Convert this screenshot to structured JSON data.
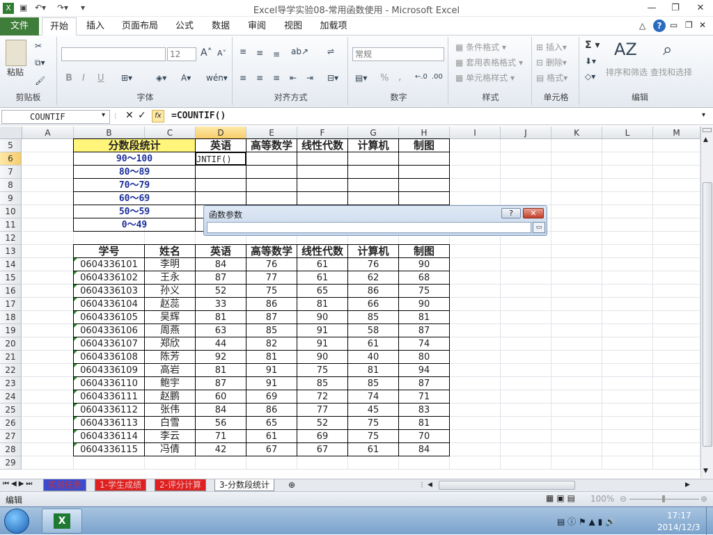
{
  "window": {
    "title": "Excel导学实验08-常用函数使用 - Microsoft Excel"
  },
  "quick_access": {
    "save_icon": "save-icon",
    "undo_icon": "undo-icon",
    "redo_icon": "redo-icon",
    "customize_icon": "dropdown-icon"
  },
  "ribbon_tabs": [
    "文件",
    "开始",
    "插入",
    "页面布局",
    "公式",
    "数据",
    "审阅",
    "视图",
    "加载项"
  ],
  "ribbon": {
    "clipboard": {
      "paste": "粘贴",
      "label": "剪贴板"
    },
    "font": {
      "font_name": "",
      "font_size": "12",
      "bold": "B",
      "italic": "I",
      "underline": "U",
      "label": "字体"
    },
    "alignment": {
      "label": "对齐方式"
    },
    "number": {
      "format": "常规",
      "percent": "%",
      "comma": ",",
      "label": "数字"
    },
    "styles": {
      "cond": "条件格式",
      "table": "套用表格格式",
      "cell": "单元格样式",
      "label": "样式"
    },
    "cells": {
      "insert": "插入",
      "delete": "删除",
      "format": "格式",
      "label": "单元格"
    },
    "editing": {
      "sum": "Σ",
      "sort": "排序和筛选",
      "find": "查找和选择",
      "label": "编辑"
    }
  },
  "formula_bar": {
    "name_box": "COUNTIF",
    "fx": "fx",
    "formula": "=COUNTIF()"
  },
  "columns": [
    "A",
    "B",
    "C",
    "D",
    "E",
    "F",
    "G",
    "H",
    "I",
    "J",
    "K",
    "L",
    "M"
  ],
  "rows": [
    "5",
    "6",
    "7",
    "8",
    "9",
    "10",
    "11",
    "12",
    "13",
    "14",
    "15",
    "16",
    "17",
    "18",
    "19",
    "20",
    "21",
    "22",
    "23",
    "24",
    "25",
    "26",
    "27",
    "28",
    "29"
  ],
  "summary_table": {
    "title": "分数段统计",
    "headers": [
      "英语",
      "高等数学",
      "线性代数",
      "计算机",
      "制图"
    ],
    "ranges": [
      "90～100",
      "80～89",
      "70～79",
      "60～69",
      "50～59",
      "0～49"
    ],
    "active_cell_text": "JNTIF()"
  },
  "score_table": {
    "headers": [
      "学号",
      "姓名",
      "英语",
      "高等数学",
      "线性代数",
      "计算机",
      "制图"
    ],
    "rows": [
      [
        "0604336101",
        "李明",
        "84",
        "76",
        "61",
        "76",
        "90"
      ],
      [
        "0604336102",
        "王永",
        "87",
        "77",
        "61",
        "62",
        "68"
      ],
      [
        "0604336103",
        "孙义",
        "52",
        "75",
        "65",
        "86",
        "75"
      ],
      [
        "0604336104",
        "赵蕊",
        "33",
        "86",
        "81",
        "66",
        "90"
      ],
      [
        "0604336105",
        "吴辉",
        "81",
        "87",
        "90",
        "85",
        "81"
      ],
      [
        "0604336106",
        "周燕",
        "63",
        "85",
        "91",
        "58",
        "87"
      ],
      [
        "0604336107",
        "郑欣",
        "44",
        "82",
        "91",
        "61",
        "74"
      ],
      [
        "0604336108",
        "陈芳",
        "92",
        "81",
        "90",
        "40",
        "80"
      ],
      [
        "0604336109",
        "高岩",
        "81",
        "91",
        "75",
        "81",
        "94"
      ],
      [
        "0604336110",
        "鲍宇",
        "87",
        "91",
        "85",
        "85",
        "87"
      ],
      [
        "0604336111",
        "赵鹏",
        "60",
        "69",
        "72",
        "74",
        "71"
      ],
      [
        "0604336112",
        "张伟",
        "84",
        "86",
        "77",
        "45",
        "83"
      ],
      [
        "0604336113",
        "白雪",
        "56",
        "65",
        "52",
        "75",
        "81"
      ],
      [
        "0604336114",
        "李云",
        "71",
        "61",
        "69",
        "75",
        "70"
      ],
      [
        "0604336115",
        "冯倩",
        "42",
        "67",
        "67",
        "61",
        "84"
      ]
    ]
  },
  "dialog": {
    "title": "函数参数",
    "help": "?",
    "close": "✕"
  },
  "sheet_tabs": [
    "实验任务",
    "1-学生成绩",
    "2-评分计算",
    "3-分数段统计"
  ],
  "status": {
    "mode": "编辑",
    "zoom": "100%"
  },
  "taskbar": {
    "time": "17:17",
    "date": "2014/12/3"
  }
}
